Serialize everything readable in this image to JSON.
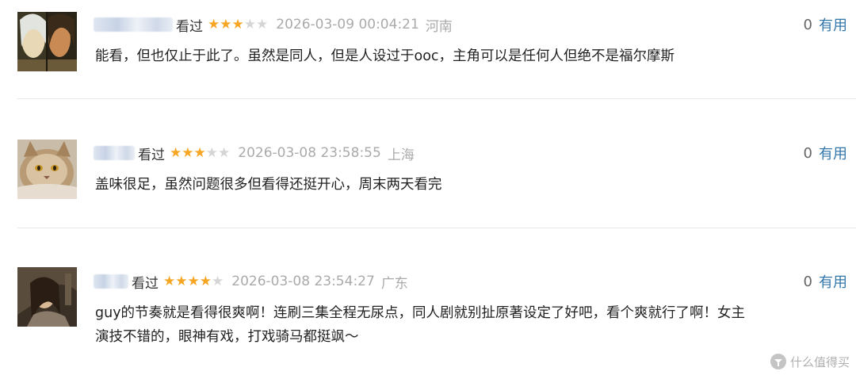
{
  "comments": [
    {
      "watched": "看过",
      "rating": 3,
      "time": "2026-03-09 00:04:21",
      "location": "河南",
      "useful_count": "0",
      "useful_label": "有用",
      "text": "能看，但也仅止于此了。虽然是同人，但是人设过于ooc，主角可以是任何人但绝不是福尔摩斯"
    },
    {
      "watched": "看过",
      "rating": 3,
      "time": "2026-03-08 23:58:55",
      "location": "上海",
      "useful_count": "0",
      "useful_label": "有用",
      "text": "盖味很足，虽然问题很多但看得还挺开心，周末两天看完"
    },
    {
      "watched": "看过",
      "rating": 4,
      "time": "2026-03-08 23:54:27",
      "location": "广东",
      "useful_count": "0",
      "useful_label": "有用",
      "text_line1": "guy的节奏就是看得很爽啊！连刷三集全程无尿点，同人剧就别扯原著设定了好吧，看个爽就行了啊！女主",
      "text_line2": "演技不错的，眼神有戏，打戏骑马都挺飒～"
    }
  ],
  "watermark": "什么值得买",
  "colors": {
    "star_on": "#f6a623",
    "star_off": "#d5d5d5",
    "link": "#3377aa",
    "muted": "#aaaaaa"
  }
}
